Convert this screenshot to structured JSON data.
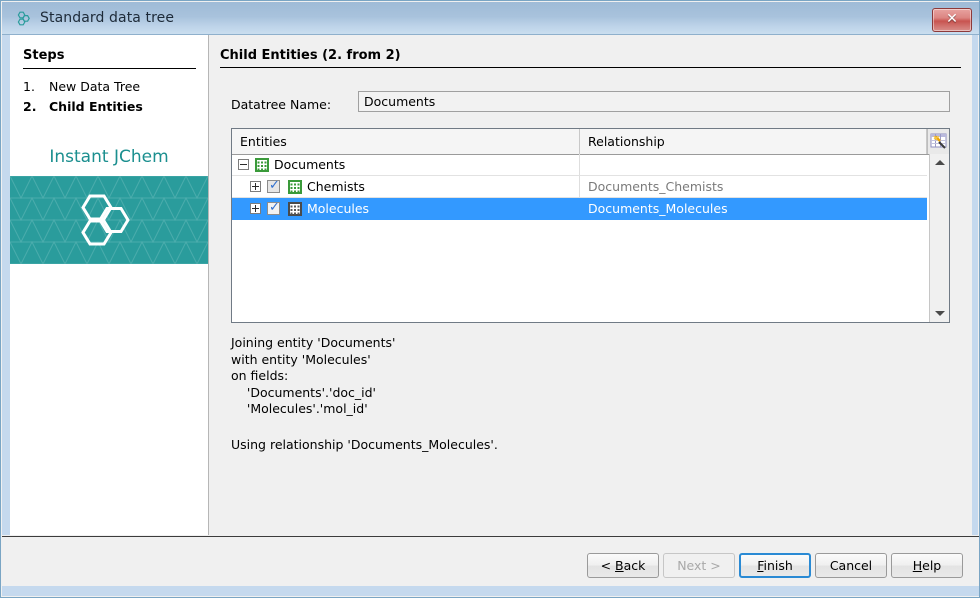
{
  "window": {
    "title": "Standard data tree",
    "title_icon": "molecule-icon",
    "close_label": "✕"
  },
  "sidebar": {
    "heading": "Steps",
    "steps": [
      {
        "num": "1.",
        "label": "New Data Tree",
        "current": false
      },
      {
        "num": "2.",
        "label": "Child Entities",
        "current": true
      }
    ],
    "brand": {
      "name": "Instant JChem",
      "logo_icon": "hexagon-cluster-logo",
      "color": "#2a9c9c"
    }
  },
  "main": {
    "page_title": "Child Entities (2. from 2)",
    "datatree_name_label": "Datatree Name:",
    "datatree_name_value": "Documents",
    "datatree_name_placeholder": "",
    "table": {
      "columns": [
        "Entities",
        "Relationship"
      ],
      "column_chooser_icon": "column-chooser-icon",
      "rows": [
        {
          "entity": "Documents",
          "relationship": "",
          "indent": 0,
          "toggle": "minus",
          "checkbox": null,
          "icon": "grid-icon-green",
          "selected": false
        },
        {
          "entity": "Chemists",
          "relationship": "Documents_Chemists",
          "indent": 1,
          "toggle": "plus",
          "checkbox": "checked",
          "icon": "grid-icon-green",
          "selected": false
        },
        {
          "entity": "Molecules",
          "relationship": "Documents_Molecules",
          "indent": 1,
          "toggle": "plus",
          "checkbox": "checked",
          "icon": "grid-icon-gray",
          "selected": true
        }
      ],
      "scroll_up_icon": "scroll-up-arrow",
      "scroll_down_icon": "scroll-down-arrow"
    },
    "description_block": "Joining entity 'Documents'\nwith entity 'Molecules'\non fields:\n    'Documents'.'doc_id'\n    'Molecules'.'mol_id'",
    "description_footer": "Using relationship 'Documents_Molecules'."
  },
  "footer": {
    "buttons": [
      {
        "id": "back",
        "label": "< Back",
        "mnemonic": "B",
        "disabled": false,
        "default": false
      },
      {
        "id": "next",
        "label": "Next >",
        "mnemonic": "",
        "disabled": true,
        "default": false
      },
      {
        "id": "finish",
        "label": "Finish",
        "mnemonic": "F",
        "disabled": false,
        "default": true
      },
      {
        "id": "cancel",
        "label": "Cancel",
        "mnemonic": "",
        "disabled": false,
        "default": false
      },
      {
        "id": "help",
        "label": "Help",
        "mnemonic": "H",
        "disabled": false,
        "default": false
      }
    ]
  },
  "colors": {
    "selection_blue": "#3399ff",
    "brand_teal": "#2a9c9c",
    "titlebar_blue": "#a8c2dc",
    "panel_gray": "#f0f0f0"
  }
}
